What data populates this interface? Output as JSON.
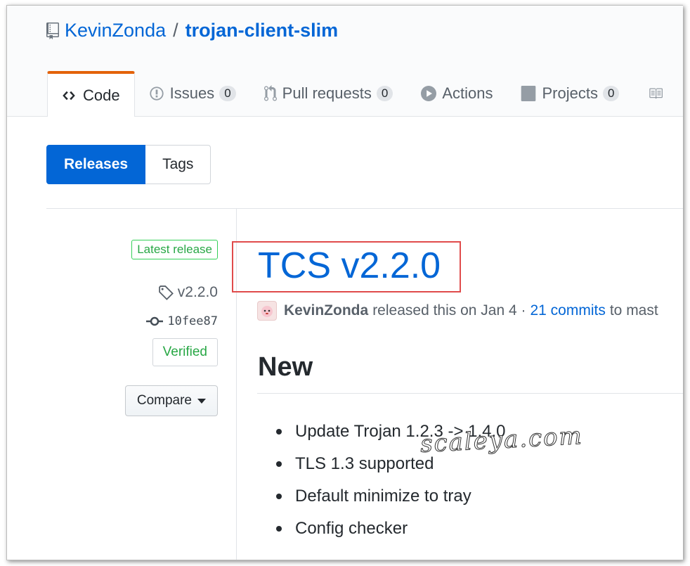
{
  "repo": {
    "owner": "KevinZonda",
    "separator": "/",
    "name": "trojan-client-slim"
  },
  "tabs": [
    {
      "label": "Code",
      "icon": "code-icon",
      "selected": true
    },
    {
      "label": "Issues",
      "icon": "issue-opened-icon",
      "count": "0"
    },
    {
      "label": "Pull requests",
      "icon": "git-pull-request-icon",
      "count": "0"
    },
    {
      "label": "Actions",
      "icon": "play-icon"
    },
    {
      "label": "Projects",
      "icon": "project-icon",
      "count": "0"
    },
    {
      "label": "",
      "icon": "book-icon"
    }
  ],
  "subnav": {
    "releases": "Releases",
    "tags": "Tags"
  },
  "release": {
    "latest_label": "Latest release",
    "tag": "v2.2.0",
    "commit": "10fee87",
    "verified": "Verified",
    "compare": "Compare",
    "title": "TCS v2.2.0",
    "author": "KevinZonda",
    "released_text": "released this on Jan 4 ·",
    "commits_link": "21 commits",
    "commits_suffix": "to mast",
    "section_title": "New",
    "notes": [
      "Update Trojan 1.2.3 -> 1.4.0",
      "TLS 1.3 supported",
      "Default minimize to tray",
      "Config checker"
    ]
  },
  "watermark": "scaleya.com",
  "colors": {
    "link": "#0366d6",
    "selected_tab_border": "#e36209",
    "primary_button": "#0366d6",
    "success": "#28a745",
    "highlight": "#e04b4b"
  }
}
